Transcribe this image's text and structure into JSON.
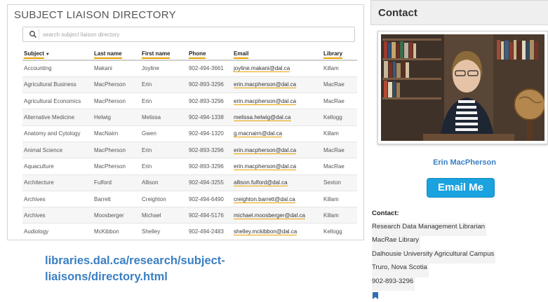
{
  "directory": {
    "title": "SUBJECT LIAISON DIRECTORY",
    "search": {
      "placeholder": "search subject liaison directory",
      "icon": "search-icon"
    },
    "columns": [
      "Subject",
      "Last name",
      "First name",
      "Phone",
      "Email",
      "Library"
    ],
    "sort_column": "Subject",
    "rows": [
      [
        "Accounting",
        "Makani",
        "Joyline",
        "902-494-3661",
        "joyline.makani@dal.ca",
        "Killam"
      ],
      [
        "Agricultural Business",
        "MacPherson",
        "Erin",
        "902-893-3296",
        "erin.macpherson@dal.ca",
        "MacRae"
      ],
      [
        "Agricultural Economics",
        "MacPherson",
        "Erin",
        "902-893-3296",
        "erin.macpherson@dal.ca",
        "MacRae"
      ],
      [
        "Alternative Medicine",
        "Helwig",
        "Melissa",
        "902-494-1338",
        "melissa.helwig@dal.ca",
        "Kellogg"
      ],
      [
        "Anatomy and Cytology",
        "MacNairn",
        "Gwen",
        "902-494-1320",
        "g.macnairn@dal.ca",
        "Killam"
      ],
      [
        "Animal Science",
        "MacPherson",
        "Erin",
        "902-893-3296",
        "erin.macpherson@dal.ca",
        "MacRae"
      ],
      [
        "Aquaculture",
        "MacPherson",
        "Erin",
        "902-893-3296",
        "erin.macpherson@dal.ca",
        "MacRae"
      ],
      [
        "Architecture",
        "Fulford",
        "Allison",
        "902-494-3255",
        "allison.fulford@dal.ca",
        "Sexton"
      ],
      [
        "Archives",
        "Barrett",
        "Creighton",
        "902-494-6490",
        "creighton.barrett@dal.ca",
        "Killam"
      ],
      [
        "Archives",
        "Moosberger",
        "Michael",
        "902-494-5176",
        "michael.moosberger@dal.ca",
        "Killam"
      ],
      [
        "Audiology",
        "McKibbon",
        "Shelley",
        "902-494-2483",
        "shelley.mckibbon@dal.ca",
        "Kellogg"
      ]
    ]
  },
  "url_caption": "libraries.dal.ca/research/subject-liaisons/directory.html",
  "contact": {
    "header": "Contact",
    "name": "Erin MacPherson",
    "button_label": "Email Me",
    "label": "Contact:",
    "lines": [
      "Research Data Management Librarian",
      "MacRae Library",
      "Dalhousie University Agricultural Campus",
      "Truro, Nova Scotia",
      "902-893-3296"
    ]
  },
  "colors": {
    "accent_underline": "#e8a100",
    "link_blue": "#3a7fc3",
    "button_blue": "#1aa3df"
  }
}
